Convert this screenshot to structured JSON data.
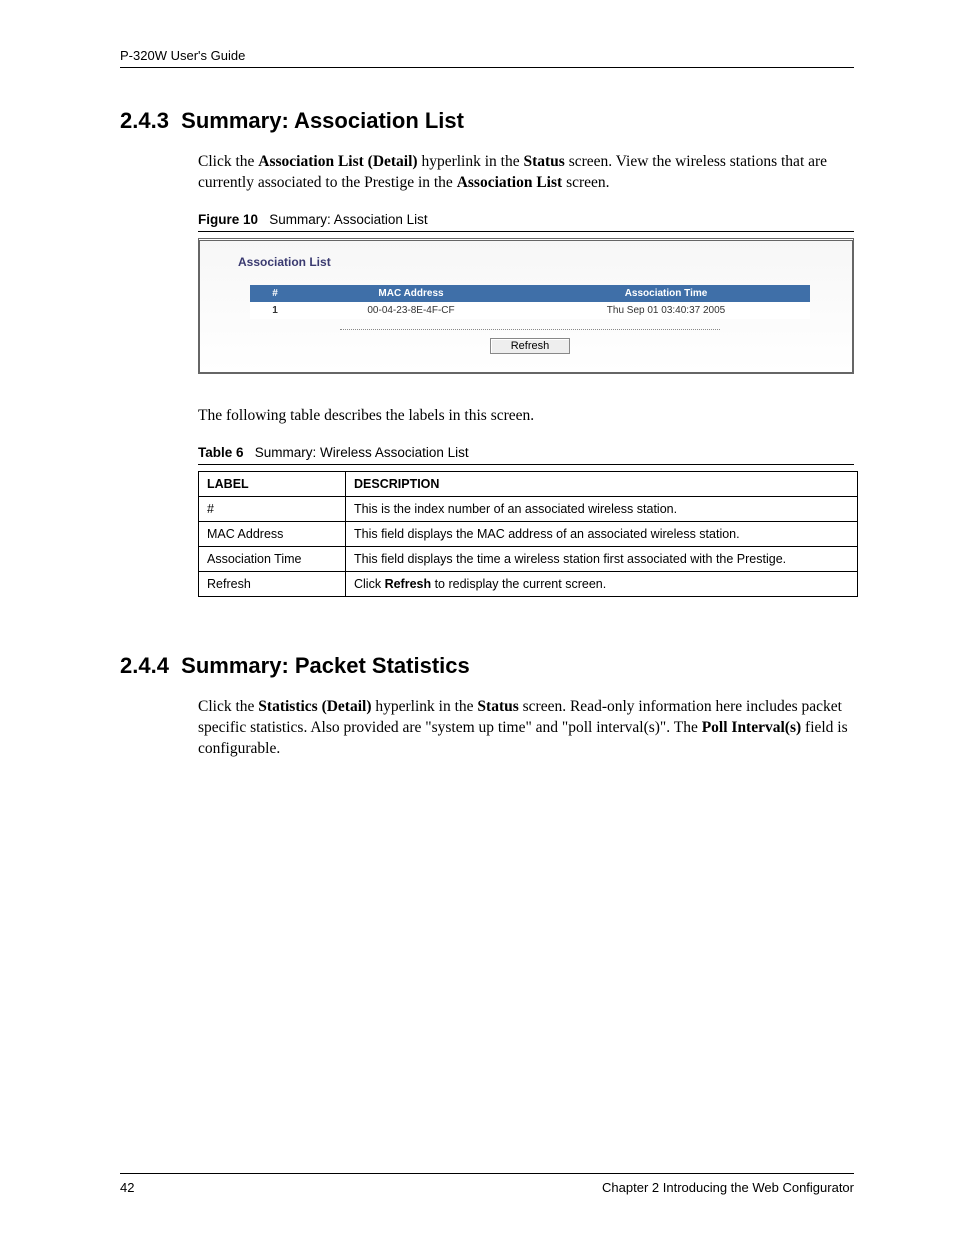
{
  "header": {
    "running": "P-320W User's Guide"
  },
  "section1": {
    "number": "2.4.3",
    "title": "Summary: Association List",
    "para_parts": [
      "Click the ",
      "Association List (Detail)",
      " hyperlink in the ",
      "Status",
      " screen. View the wireless stations that are currently associated to the Prestige in the ",
      "Association List",
      " screen."
    ]
  },
  "figure": {
    "label": "Figure 10",
    "caption": "Summary: Association List",
    "panel_title": "Association List",
    "columns": {
      "idx": "#",
      "mac": "MAC Address",
      "time": "Association Time"
    },
    "rows": [
      {
        "idx": "1",
        "mac": "00-04-23-8E-4F-CF",
        "time": "Thu Sep 01 03:40:37 2005"
      }
    ],
    "refresh": "Refresh"
  },
  "mid_para": "The following table describes the labels in this screen.",
  "table6": {
    "label": "Table 6",
    "caption": "Summary: Wireless Association List",
    "head": {
      "label": "LABEL",
      "desc": "DESCRIPTION"
    },
    "rows": [
      {
        "label": "#",
        "desc": "This is the index number of an associated wireless station."
      },
      {
        "label": "MAC Address",
        "desc": "This field displays the MAC address of an associated wireless station."
      },
      {
        "label": "Association Time",
        "desc": "This field displays the time a wireless station first associated with the Prestige."
      },
      {
        "label": "Refresh",
        "desc_pre": "Click ",
        "desc_bold": "Refresh",
        "desc_post": " to redisplay the current screen."
      }
    ]
  },
  "section2": {
    "number": "2.4.4",
    "title": "Summary: Packet Statistics",
    "para_parts": [
      "Click the ",
      "Statistics (Detail)",
      " hyperlink in the ",
      "Status",
      " screen. Read-only information here includes packet specific statistics. Also provided are \"system up time\" and \"poll interval(s)\". The ",
      "Poll Interval(s)",
      " field is configurable."
    ]
  },
  "footer": {
    "page": "42",
    "chapter": "Chapter 2 Introducing the Web Configurator"
  }
}
